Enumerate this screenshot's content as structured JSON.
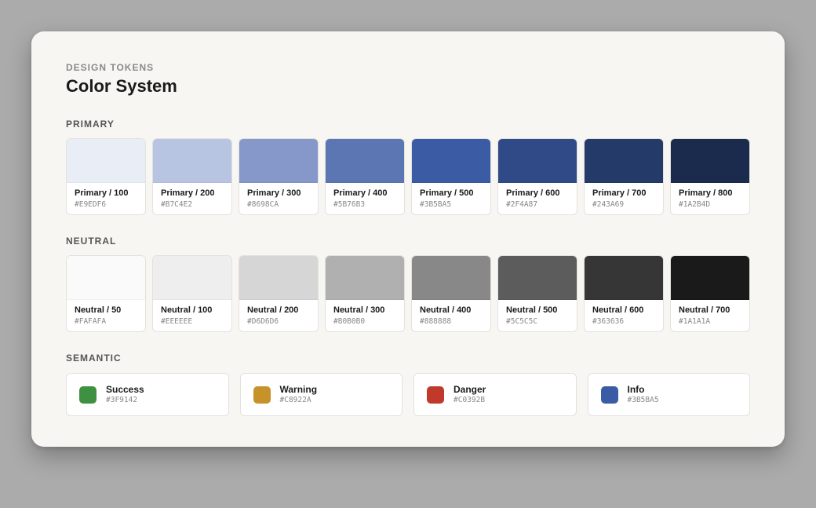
{
  "header": {
    "eyebrow": "DESIGN TOKENS",
    "title": "Color System"
  },
  "primary": {
    "title": "PRIMARY",
    "swatches": [
      {
        "name": "Primary / 100",
        "hex": "#E9EDF6"
      },
      {
        "name": "Primary / 200",
        "hex": "#B7C4E2"
      },
      {
        "name": "Primary / 300",
        "hex": "#8698CA"
      },
      {
        "name": "Primary / 400",
        "hex": "#5B76B3"
      },
      {
        "name": "Primary / 500",
        "hex": "#3B5BA5"
      },
      {
        "name": "Primary / 600",
        "hex": "#2F4A87"
      },
      {
        "name": "Primary / 700",
        "hex": "#243A69"
      },
      {
        "name": "Primary / 800",
        "hex": "#1A2B4D"
      }
    ]
  },
  "neutral": {
    "title": "NEUTRAL",
    "swatches": [
      {
        "name": "Neutral / 50",
        "hex": "#FAFAFA"
      },
      {
        "name": "Neutral / 100",
        "hex": "#EEEEEE"
      },
      {
        "name": "Neutral / 200",
        "hex": "#D6D6D6"
      },
      {
        "name": "Neutral / 300",
        "hex": "#B0B0B0"
      },
      {
        "name": "Neutral / 400",
        "hex": "#888888"
      },
      {
        "name": "Neutral / 500",
        "hex": "#5C5C5C"
      },
      {
        "name": "Neutral / 600",
        "hex": "#363636"
      },
      {
        "name": "Neutral / 700",
        "hex": "#1A1A1A"
      }
    ]
  },
  "semantic": {
    "title": "SEMANTIC",
    "items": [
      {
        "name": "Success",
        "hex": "#3F9142"
      },
      {
        "name": "Warning",
        "hex": "#C8922A"
      },
      {
        "name": "Danger",
        "hex": "#C0392B"
      },
      {
        "name": "Info",
        "hex": "#3B5BA5"
      }
    ]
  }
}
